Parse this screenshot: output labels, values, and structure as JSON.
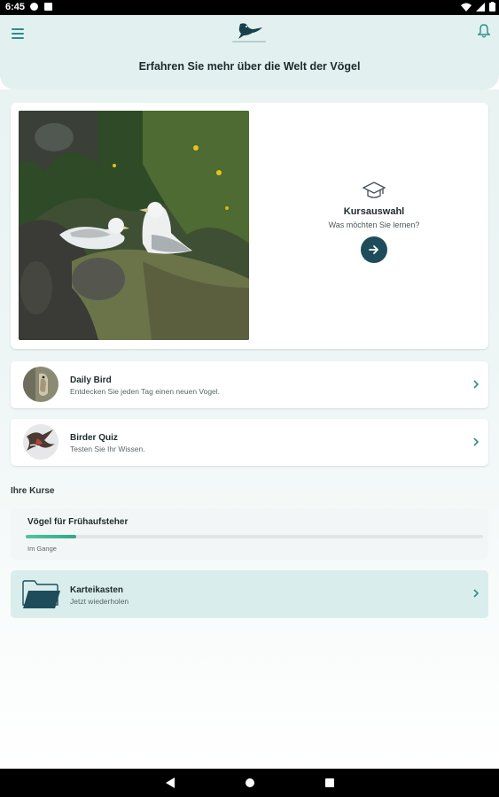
{
  "status_bar": {
    "time": "6:45"
  },
  "header": {
    "title": "Erfahren Sie mehr über die Welt der Vögel",
    "logo_text": "birdcoach"
  },
  "hero": {
    "cta_title": "Kursauswahl",
    "cta_subtitle": "Was möchten Sie lernen?"
  },
  "cards": [
    {
      "title": "Daily Bird",
      "subtitle": "Entdecken Sie jeden Tag einen neuen Vogel."
    },
    {
      "title": "Birder Quiz",
      "subtitle": "Testen Sie Ihr Wissen."
    }
  ],
  "courses": {
    "section_title": "Ihre Kurse",
    "items": [
      {
        "title": "Vögel für Frühaufsteher",
        "status": "Im Gange",
        "progress": 0.11
      }
    ]
  },
  "flashcards": {
    "title": "Karteikasten",
    "subtitle": "Jetzt wiederholen"
  },
  "colors": {
    "accent": "#2a8f86",
    "header_bg": "#e2f1f0",
    "button_dark": "#1e4c5a",
    "progress": "#3dbb93",
    "flashcard_bg": "#d9eeec"
  }
}
